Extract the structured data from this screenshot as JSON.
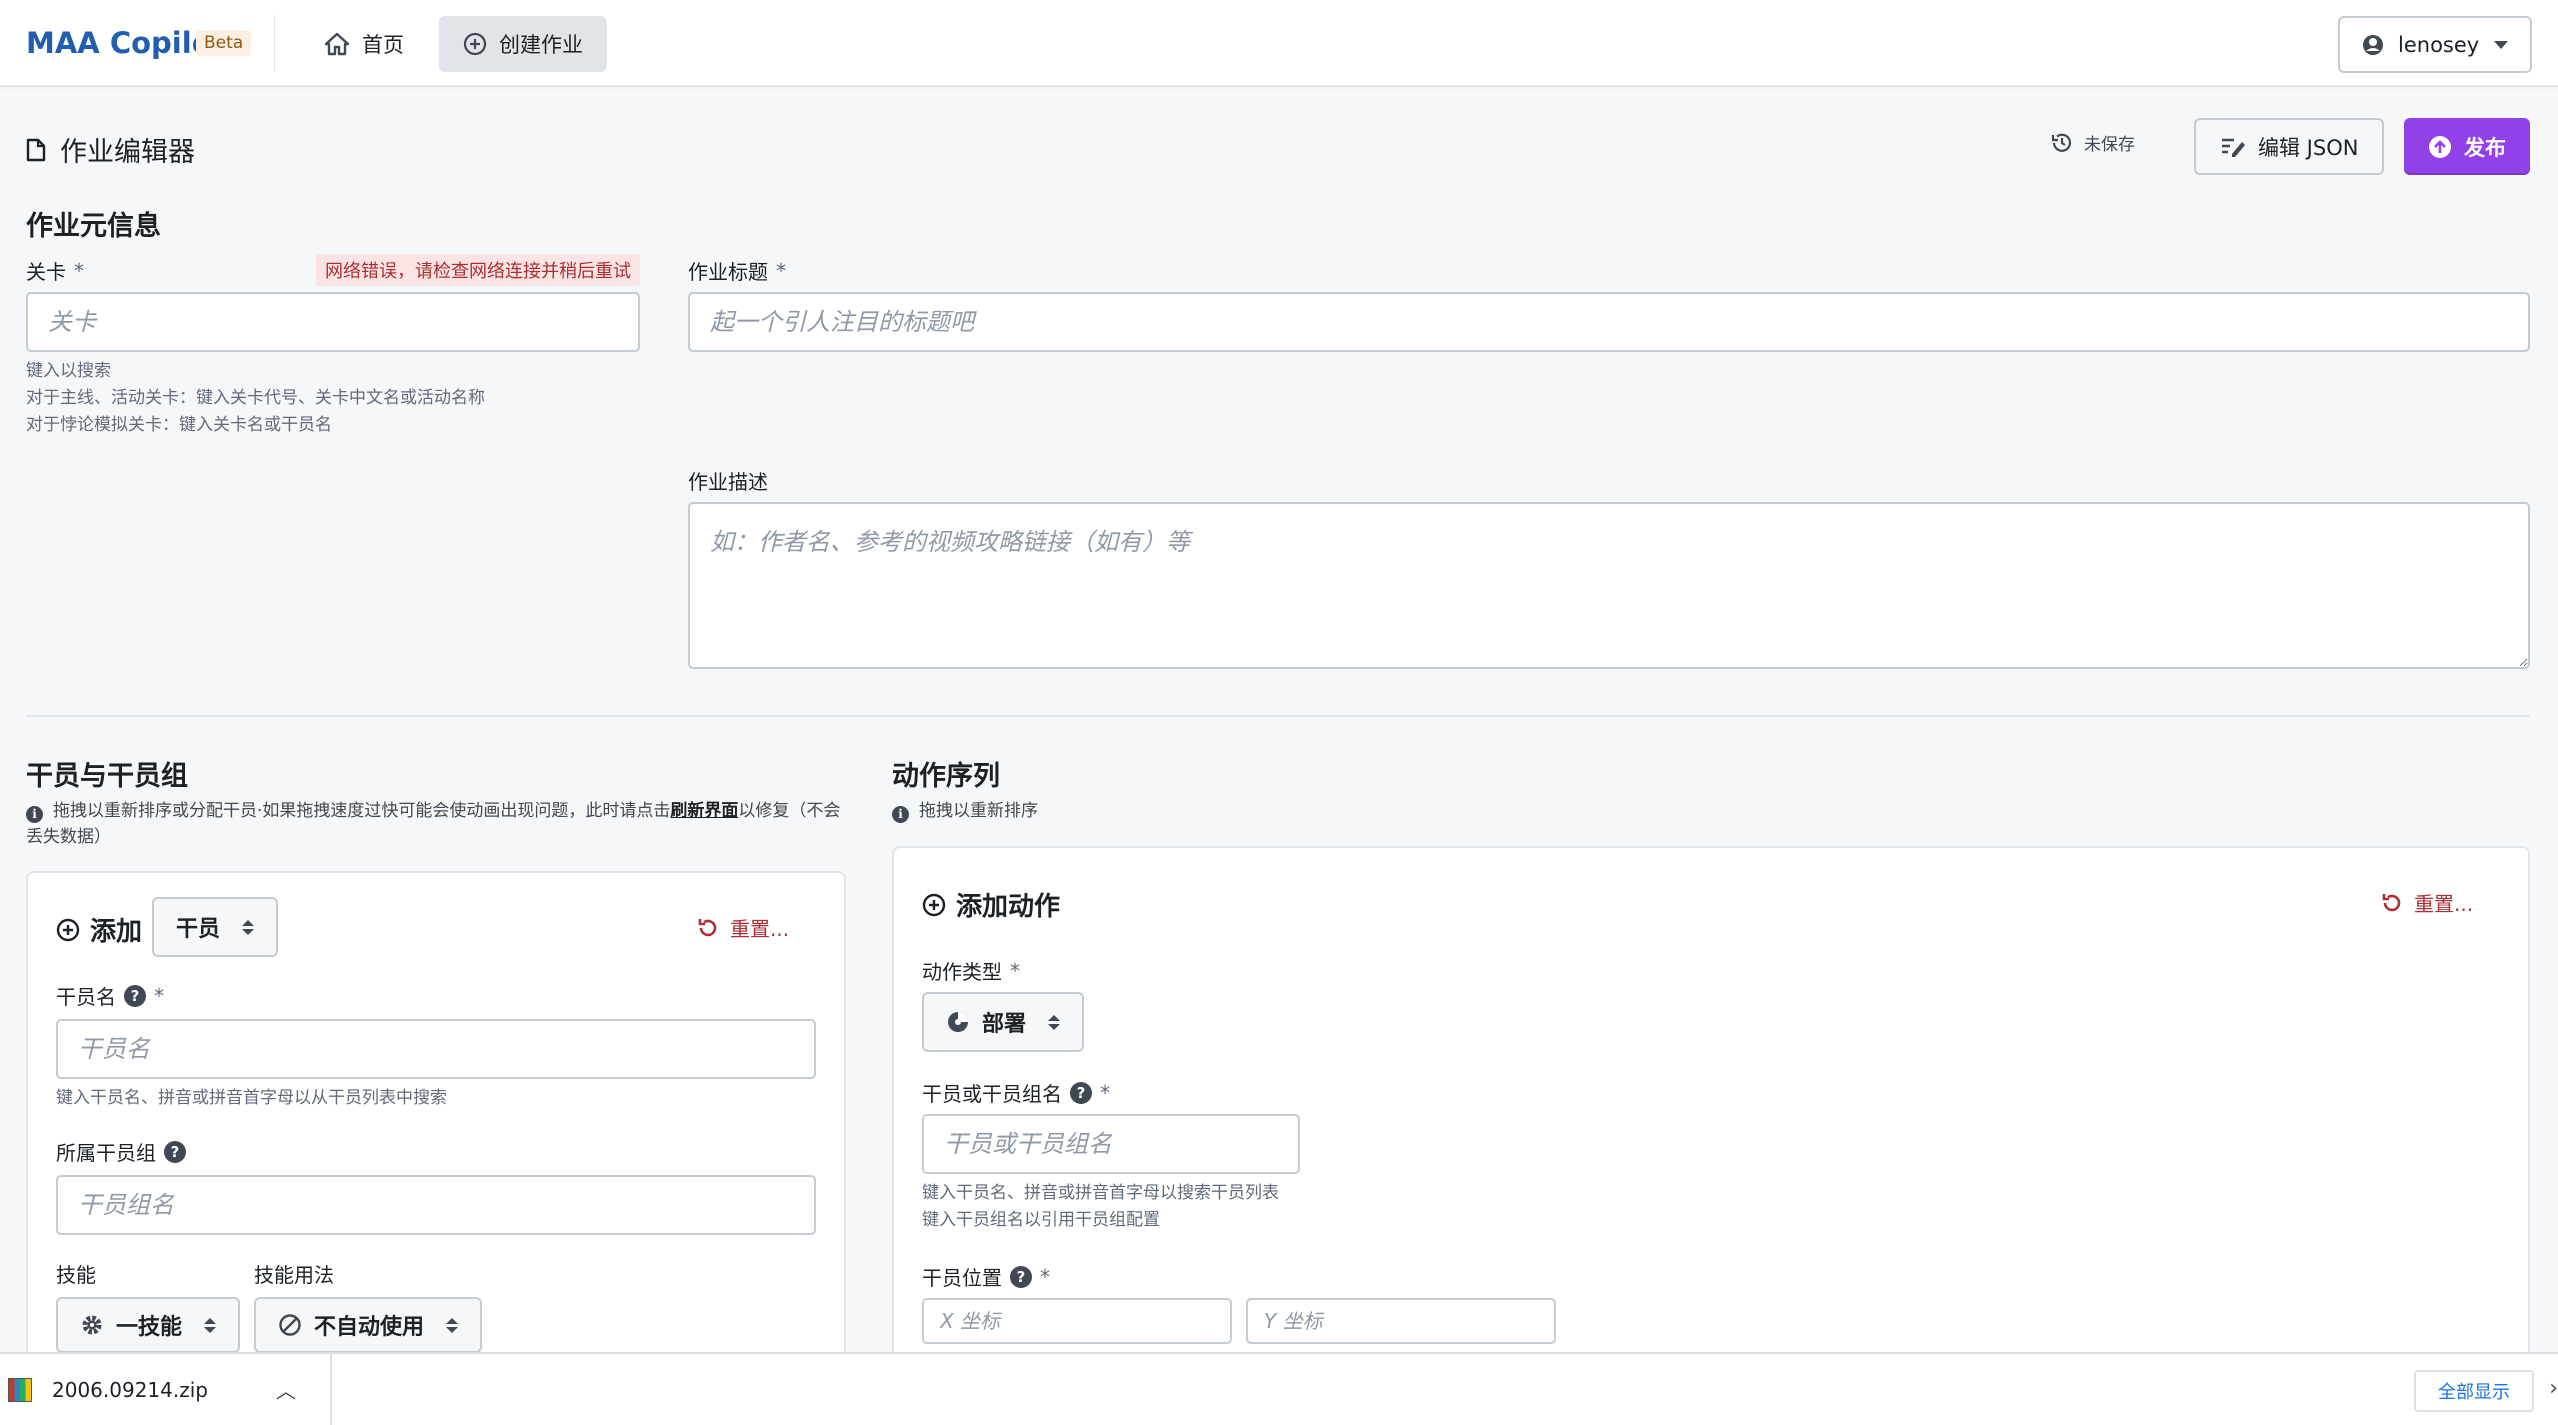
{
  "app": {
    "brand": "MAA Copilot",
    "beta": "Beta",
    "nav": [
      {
        "label": "首页",
        "icon": "home-icon"
      },
      {
        "label": "创建作业",
        "icon": "add-circle-icon"
      }
    ],
    "user": "lenosey"
  },
  "editor": {
    "title": "作业编辑器",
    "unsaved": "未保存",
    "edit_json": "编辑 JSON",
    "publish": "发布"
  },
  "meta": {
    "heading": "作业元信息",
    "stage_label": "关卡",
    "required": "*",
    "stage_error": "网络错误，请检查网络连接并稍后重试",
    "stage_placeholder": "关卡",
    "stage_help": [
      "键入以搜索",
      "对于主线、活动关卡：键入关卡代号、关卡中文名或活动名称",
      "对于悖论模拟关卡：键入关卡名或干员名"
    ],
    "title_label": "作业标题",
    "title_placeholder": "起一个引人注目的标题吧",
    "desc_label": "作业描述",
    "desc_placeholder": "如：作者名、参考的视频攻略链接（如有）等"
  },
  "operators": {
    "heading": "干员与干员组",
    "info_before": "拖拽以重新排序或分配干员·如果拖拽速度过快可能会使动画出现问题，此时请点击",
    "info_link": "刷新界面",
    "info_after": "以修复（不会丢失数据）",
    "add": "添加",
    "type_select": "干员",
    "reset": "重置...",
    "name_label": "干员名",
    "name_placeholder": "干员名",
    "name_help": "键入干员名、拼音或拼音首字母以从干员列表中搜索",
    "group_label": "所属干员组",
    "group_placeholder": "干员组名",
    "skill_label": "技能",
    "skill_value": "一技能",
    "usage_label": "技能用法",
    "usage_value": "不自动使用"
  },
  "actions": {
    "heading": "动作序列",
    "info": "拖拽以重新排序",
    "add": "添加动作",
    "reset": "重置...",
    "type_label": "动作类型",
    "type_value": "部署",
    "target_label": "干员或干员组名",
    "target_placeholder": "干员或干员组名",
    "target_help": [
      "键入干员名、拼音或拼音首字母以搜索干员列表",
      "键入干员组名以引用干员组配置"
    ],
    "pos_label": "干员位置",
    "x_placeholder": "X 坐标",
    "y_placeholder": "Y 坐标"
  },
  "downloads": {
    "file": "2006.09214.zip",
    "show_all": "全部显示"
  },
  "colors": {
    "brand": "#215db0",
    "primary": "#9241e8",
    "danger": "#ac2f33"
  }
}
